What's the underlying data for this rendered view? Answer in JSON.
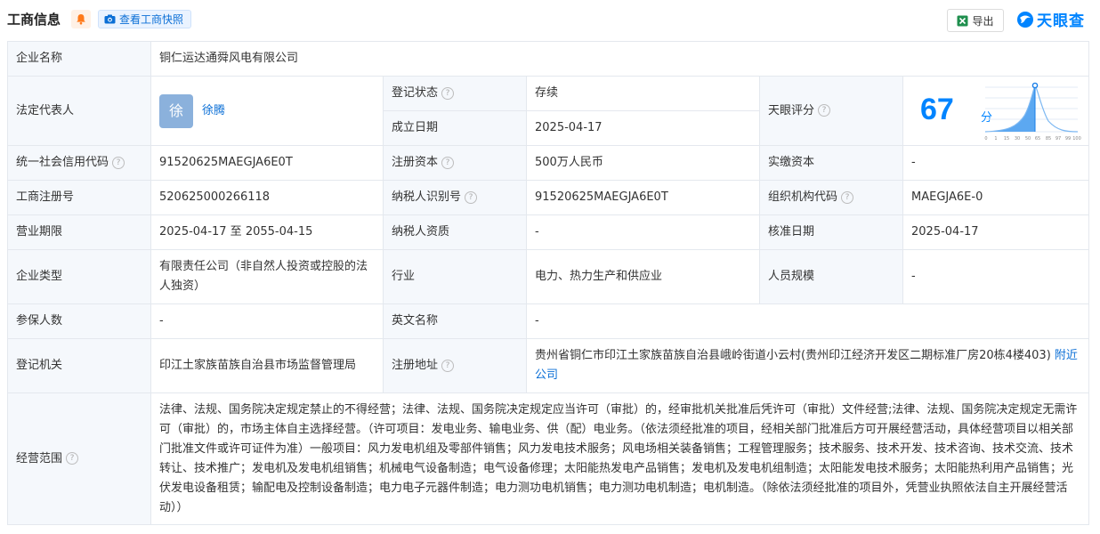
{
  "header": {
    "title": "工商信息",
    "snapshot_label": "查看工商快照",
    "export_label": "导出",
    "logo_text": "天眼查"
  },
  "labels": {
    "company_name": "企业名称",
    "legal_rep": "法定代表人",
    "reg_status": "登记状态",
    "founded": "成立日期",
    "tianyan_score": "天眼评分",
    "credit_code": "统一社会信用代码",
    "reg_capital": "注册资本",
    "paid_capital": "实缴资本",
    "reg_number": "工商注册号",
    "taxpayer_id": "纳税人识别号",
    "org_code": "组织机构代码",
    "business_term": "营业期限",
    "taxpayer_qual": "纳税人资质",
    "approval_date": "核准日期",
    "company_type": "企业类型",
    "industry": "行业",
    "staff_size": "人员规模",
    "insured": "参保人数",
    "english_name": "英文名称",
    "reg_authority": "登记机关",
    "reg_address": "注册地址",
    "scope": "经营范围"
  },
  "values": {
    "company_name": "铜仁运达通舜风电有限公司",
    "legal_rep_avatar": "徐",
    "legal_rep_name": "徐腾",
    "reg_status": "存续",
    "founded": "2025-04-17",
    "score": "67",
    "score_unit": "分",
    "credit_code": "91520625MAEGJA6E0T",
    "reg_capital": "500万人民币",
    "paid_capital": "-",
    "reg_number": "520625000266118",
    "taxpayer_id": "91520625MAEGJA6E0T",
    "org_code": "MAEGJA6E-0",
    "business_term": "2025-04-17 至 2055-04-15",
    "taxpayer_qual": "-",
    "approval_date": "2025-04-17",
    "company_type": "有限责任公司（非自然人投资或控股的法人独资）",
    "industry": "电力、热力生产和供应业",
    "staff_size": "-",
    "insured": "-",
    "english_name": "-",
    "reg_authority": "印江土家族苗族自治县市场监督管理局",
    "reg_address": "贵州省铜仁市印江土家族苗族自治县峨岭街道小云村(贵州印江经济开发区二期标准厂房20栋4楼403)",
    "nearby_link": "附近公司",
    "scope": "法律、法规、国务院决定规定禁止的不得经营；法律、法规、国务院决定规定应当许可（审批）的，经审批机关批准后凭许可（审批）文件经营;法律、法规、国务院决定规定无需许可（审批）的，市场主体自主选择经营。（许可项目：发电业务、输电业务、供（配）电业务。（依法须经批准的项目，经相关部门批准后方可开展经营活动，具体经营项目以相关部门批准文件或许可证件为准）一般项目：风力发电机组及零部件销售；风力发电技术服务；风电场相关装备销售；工程管理服务；技术服务、技术开发、技术咨询、技术交流、技术转让、技术推广；发电机及发电机组销售；机械电气设备制造；电气设备修理；太阳能热发电产品销售；发电机及发电机组制造；太阳能发电技术服务；太阳能热利用产品销售；光伏发电设备租赁；输配电及控制设备制造；电力电子元器件制造；电力测功电机销售；电力测功电机制造；电机制造。（除依法须经批准的项目外，凭营业执照依法自主开展经营活动））"
  },
  "score_axis_ticks": [
    "0",
    "1",
    "15",
    "30",
    "50",
    "65",
    "85",
    "97",
    "99",
    "100"
  ],
  "colors": {
    "accent": "#0084ff",
    "status_green": "#29a35a",
    "label_bg": "#f5f8fc"
  }
}
